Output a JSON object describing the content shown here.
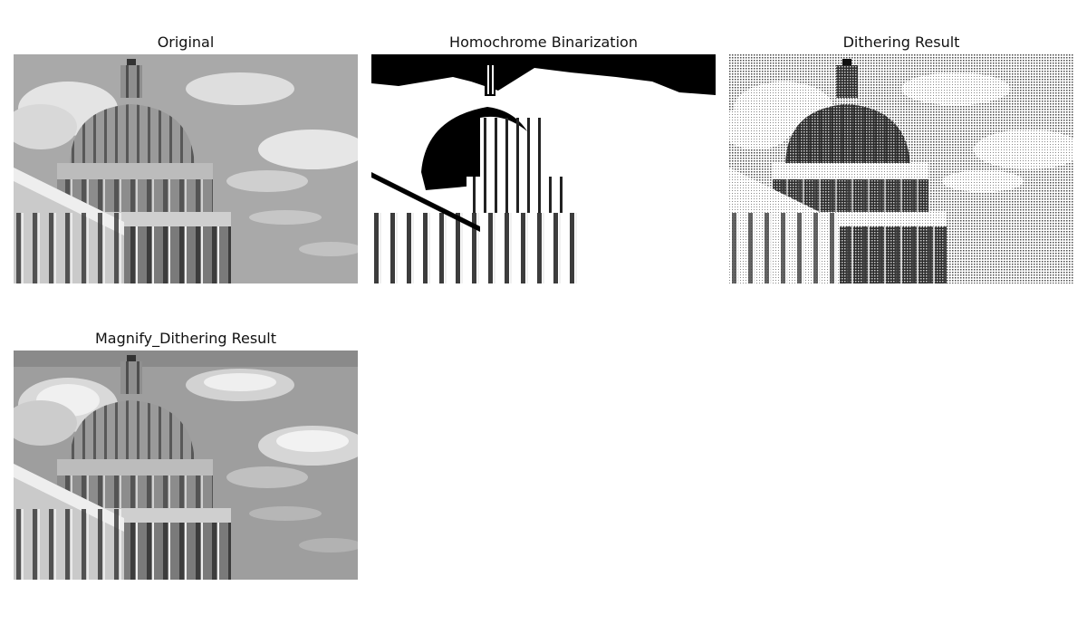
{
  "panels": [
    {
      "title": "Original",
      "style": "grayscale"
    },
    {
      "title": "Homochrome Binarization",
      "style": "binary"
    },
    {
      "title": "Dithering Result",
      "style": "dithered"
    },
    {
      "title": "Magnify_Dithering Result",
      "style": "posterized"
    }
  ]
}
